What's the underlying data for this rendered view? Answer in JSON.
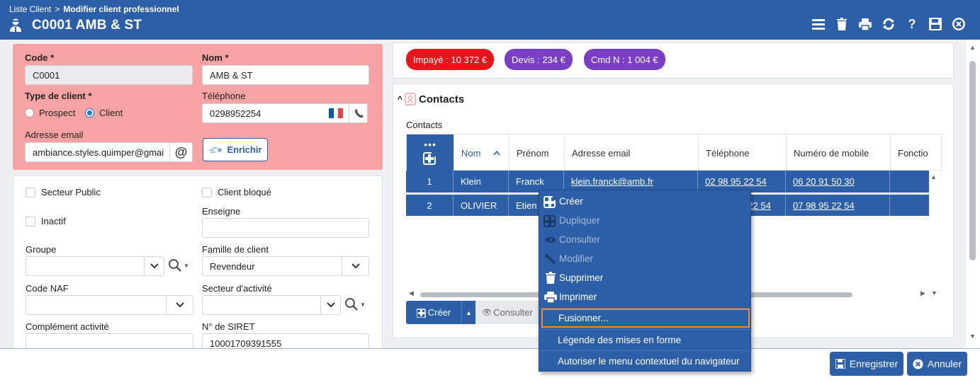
{
  "header": {
    "breadcrumb_root": "Liste Client",
    "breadcrumb_sep": ">",
    "breadcrumb_current": "Modifier client professionnel",
    "title": "C0001 AMB & ST",
    "icons": [
      "menu-icon",
      "trash-icon",
      "print-icon",
      "refresh-icon",
      "help-icon",
      "save-icon",
      "close-icon"
    ]
  },
  "form": {
    "code_label": "Code *",
    "code_value": "C0001",
    "nom_label": "Nom *",
    "nom_value": "AMB & ST",
    "type_label": "Type de client *",
    "type_options": [
      "Prospect",
      "Client"
    ],
    "type_selected": "Client",
    "telephone_label": "Téléphone",
    "telephone_value": "0298952254",
    "email_label": "Adresse email",
    "email_value": "ambiance.styles.quimper@gmail.com",
    "enrichir_label": "Enrichir"
  },
  "details": {
    "secteur_public_label": "Secteur Public",
    "client_bloque_label": "Client bloqué",
    "inactif_label": "Inactif",
    "enseigne_label": "Enseigne",
    "enseigne_value": "",
    "groupe_label": "Groupe",
    "groupe_value": "",
    "famille_label": "Famille de client",
    "famille_value": "Revendeur",
    "code_naf_label": "Code NAF",
    "code_naf_value": "",
    "secteur_label": "Secteur d'activité",
    "secteur_value": "",
    "complement_label": "Complément activité",
    "siret_label": "N° de SIRET",
    "siret_value": "10001709391555"
  },
  "badges": [
    {
      "label": "Impayé : 10 372 €",
      "color": "#e8141c"
    },
    {
      "label": "Devis : 234 €",
      "color": "#7a3fc4"
    },
    {
      "label": "Cmd N : 1 004 €",
      "color": "#7a3fc4"
    }
  ],
  "contacts": {
    "section_title": "Contacts",
    "grid_label": "Contacts",
    "columns": [
      "Nom",
      "Prénom",
      "Adresse email",
      "Téléphone",
      "Numéro de mobile",
      "Fonctio"
    ],
    "sorted_column": "Nom",
    "rows": [
      {
        "n": "1",
        "nom": "Klein",
        "prenom": "Franck",
        "email": "klein.franck@amb.fr",
        "tel": "02 98 95 22 54",
        "mobile": "06 20 91 50 30"
      },
      {
        "n": "2",
        "nom": "OLIVIER",
        "prenom": "Etien",
        "email": "",
        "tel": "22 54",
        "mobile": "07 98 95 22 54"
      }
    ],
    "create_label": "Créer",
    "consult_label": "Consulter"
  },
  "context_menu": {
    "items": [
      {
        "label": "Créer",
        "icon": "add-icon",
        "state": "enabled"
      },
      {
        "label": "Dupliquer",
        "icon": "duplicate-icon",
        "state": "disabled"
      },
      {
        "label": "Consulter",
        "icon": "eye-icon",
        "state": "disabled"
      },
      {
        "label": "Modifier",
        "icon": "pencil-icon",
        "state": "disabled"
      },
      {
        "label": "Supprimer",
        "icon": "trash-icon",
        "state": "enabled"
      },
      {
        "label": "Imprimer",
        "icon": "print-icon",
        "state": "enabled"
      },
      {
        "label": "Fusionner...",
        "icon": "",
        "state": "focused"
      },
      {
        "label": "Légende des mises en forme",
        "icon": "",
        "state": "enabled"
      },
      {
        "label": "Autoriser le menu contextuel du navigateur",
        "icon": "",
        "state": "enabled"
      }
    ]
  },
  "footer": {
    "save_label": "Enregistrer",
    "cancel_label": "Annuler"
  }
}
